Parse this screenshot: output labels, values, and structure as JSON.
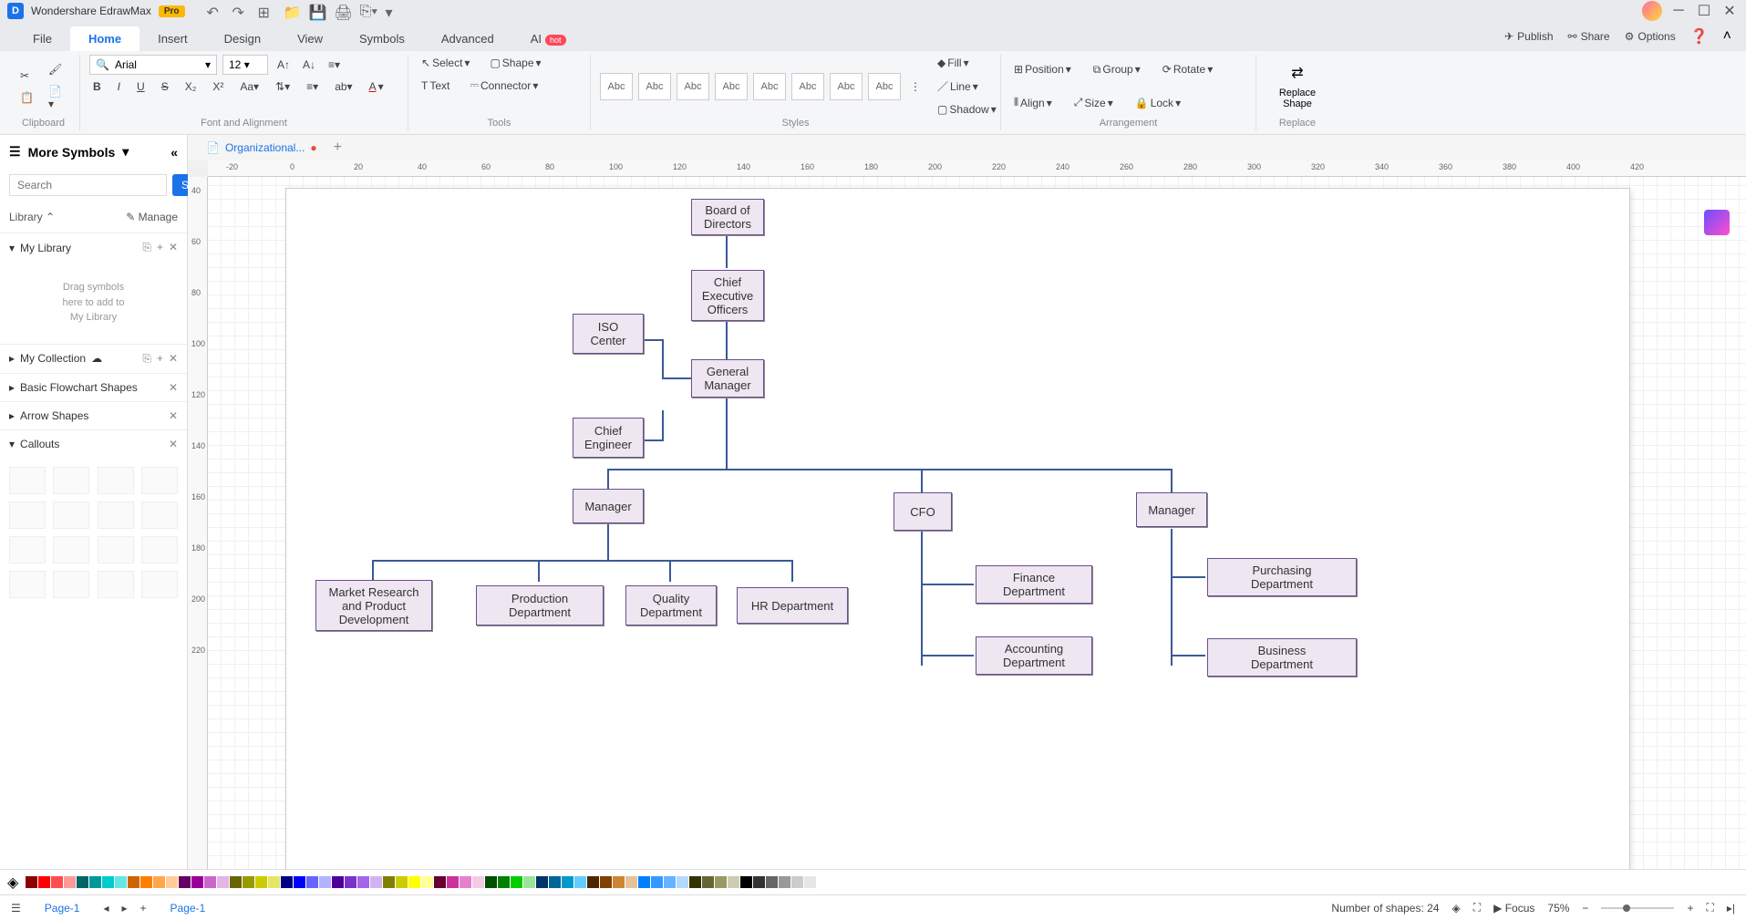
{
  "app": {
    "name": "Wondershare EdrawMax",
    "badge": "Pro"
  },
  "menu": {
    "file": "File",
    "home": "Home",
    "insert": "Insert",
    "design": "Design",
    "view": "View",
    "symbols": "Symbols",
    "advanced": "Advanced",
    "ai": "AI",
    "hot": "hot",
    "publish": "Publish",
    "share": "Share",
    "options": "Options"
  },
  "ribbon": {
    "font": "Arial",
    "size": "12",
    "select": "Select",
    "shape": "Shape",
    "text": "Text",
    "connector": "Connector",
    "style_label": "Abc",
    "fill": "Fill",
    "line": "Line",
    "shadow": "Shadow",
    "position": "Position",
    "group": "Group",
    "rotate": "Rotate",
    "align": "Align",
    "sizebtn": "Size",
    "lock": "Lock",
    "replace": "Replace\nShape",
    "g_clipboard": "Clipboard",
    "g_font": "Font and Alignment",
    "g_tools": "Tools",
    "g_styles": "Styles",
    "g_arrange": "Arrangement",
    "g_replace": "Replace"
  },
  "sidebar": {
    "title": "More Symbols",
    "search_ph": "Search",
    "search_btn": "Search",
    "library": "Library",
    "manage": "Manage",
    "mylib": "My Library",
    "empty": "Drag symbols\nhere to add to\nMy Library",
    "mycol": "My Collection",
    "flowchart": "Basic Flowchart Shapes",
    "arrows": "Arrow Shapes",
    "callouts": "Callouts"
  },
  "doc": {
    "tab": "Organizational...",
    "page": "Page-1"
  },
  "ruler_h": [
    "-20",
    "0",
    "20",
    "40",
    "60",
    "80",
    "100",
    "120",
    "140",
    "160",
    "180",
    "200",
    "220",
    "240",
    "260",
    "280",
    "300",
    "320",
    "340",
    "360",
    "380",
    "400",
    "420"
  ],
  "ruler_v": [
    "40",
    "60",
    "80",
    "100",
    "120",
    "140",
    "160",
    "180",
    "200",
    "220"
  ],
  "org": {
    "board": "Board of\nDirectors",
    "ceo": "Chief\nExecutive\nOfficers",
    "iso": "ISO\nCenter",
    "gm": "General\nManager",
    "ce": "Chief\nEngineer",
    "mgr1": "Manager",
    "cfo": "CFO",
    "mgr2": "Manager",
    "mkt": "Market Research\nand Product\nDevelopment",
    "prod": "Production\nDepartment",
    "qual": "Quality\nDepartment",
    "hr": "HR Department",
    "fin": "Finance\nDepartment",
    "acc": "Accounting\nDepartment",
    "pur": "Purchasing\nDepartment",
    "bus": "Business\nDepartment"
  },
  "status": {
    "shapes": "Number of shapes: 24",
    "focus": "Focus",
    "zoom": "75%",
    "page1": "Page-1"
  },
  "colors": [
    "#8b0000",
    "#ff0000",
    "#ff4d4d",
    "#ff9999",
    "#006666",
    "#009999",
    "#00cccc",
    "#66e5e5",
    "#cc6600",
    "#ff8000",
    "#ffa64d",
    "#ffcc99",
    "#660066",
    "#990099",
    "#cc66cc",
    "#e6b3e6",
    "#666600",
    "#999900",
    "#cccc00",
    "#e6e666",
    "#000080",
    "#0000ff",
    "#6666ff",
    "#b3b3ff",
    "#4d0099",
    "#7733cc",
    "#a366e6",
    "#d1b3f2",
    "#808000",
    "#cccc00",
    "#ffff00",
    "#ffff99",
    "#660033",
    "#cc3399",
    "#e680cc",
    "#f2cce6",
    "#004d00",
    "#008000",
    "#00cc00",
    "#99e699",
    "#003366",
    "#006699",
    "#0099cc",
    "#66ccff",
    "#4d2600",
    "#804000",
    "#cc8533",
    "#e6c299",
    "#0080ff",
    "#3399ff",
    "#66b3ff",
    "#b3d9ff",
    "#333300",
    "#666633",
    "#999966",
    "#ccccb3",
    "#000000",
    "#333333",
    "#666666",
    "#999999",
    "#cccccc",
    "#e6e6e6",
    "#ffffff"
  ]
}
